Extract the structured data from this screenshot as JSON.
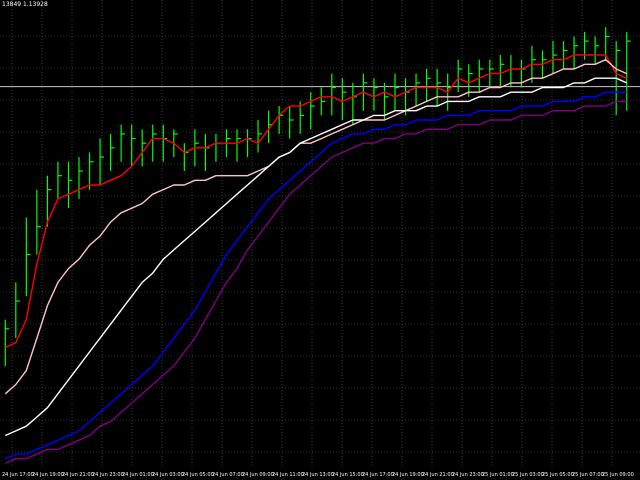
{
  "header": {
    "info": "13849 1.13928"
  },
  "chart_data": {
    "type": "line",
    "title": "",
    "xlabel": "",
    "ylabel": "",
    "grid": true,
    "ylim": [
      0,
      1
    ],
    "reference_line": 0.822,
    "x_tick_labels": [
      "24 Jun 17:00",
      "24 Jun 19:00",
      "24 Jun 21:00",
      "24 Jun 23:00",
      "24 Jun 01:00",
      "24 Jun 03:00",
      "24 Jun 05:00",
      "24 Jun 07:00",
      "24 Jun 09:00",
      "24 Jun 11:00",
      "24 Jun 13:00",
      "24 Jun 15:00",
      "24 Jun 17:00",
      "24 Jun 19:00",
      "24 Jun 21:00",
      "24 Jun 23:00",
      "25 Jun 01:00",
      "25 Jun 03:00",
      "25 Jun 05:00",
      "25 Jun 07:00",
      "25 Jun 09:00"
    ],
    "bars": {
      "color": "#00ff00",
      "close": [
        0.3,
        0.36,
        0.46,
        0.52,
        0.6,
        0.63,
        0.62,
        0.64,
        0.66,
        0.67,
        0.69,
        0.72,
        0.71,
        0.7,
        0.72,
        0.71,
        0.72,
        0.68,
        0.7,
        0.69,
        0.7,
        0.71,
        0.71,
        0.71,
        0.72,
        0.74,
        0.76,
        0.75,
        0.76,
        0.78,
        0.79,
        0.82,
        0.81,
        0.8,
        0.83,
        0.82,
        0.8,
        0.82,
        0.81,
        0.83,
        0.84,
        0.83,
        0.82,
        0.86,
        0.85,
        0.86,
        0.86,
        0.87,
        0.86,
        0.86,
        0.88,
        0.88,
        0.89,
        0.9,
        0.91,
        0.92,
        0.91,
        0.93,
        0.9,
        0.92
      ],
      "high": [
        0.32,
        0.4,
        0.54,
        0.6,
        0.63,
        0.66,
        0.66,
        0.67,
        0.68,
        0.71,
        0.72,
        0.74,
        0.74,
        0.73,
        0.74,
        0.74,
        0.73,
        0.7,
        0.73,
        0.72,
        0.72,
        0.73,
        0.73,
        0.73,
        0.75,
        0.77,
        0.78,
        0.78,
        0.79,
        0.81,
        0.82,
        0.85,
        0.84,
        0.83,
        0.85,
        0.84,
        0.83,
        0.85,
        0.84,
        0.85,
        0.86,
        0.86,
        0.85,
        0.88,
        0.87,
        0.88,
        0.88,
        0.89,
        0.89,
        0.88,
        0.91,
        0.9,
        0.92,
        0.92,
        0.93,
        0.94,
        0.93,
        0.95,
        0.92,
        0.94
      ],
      "low": [
        0.22,
        0.28,
        0.37,
        0.46,
        0.52,
        0.58,
        0.56,
        0.58,
        0.6,
        0.61,
        0.64,
        0.66,
        0.65,
        0.65,
        0.66,
        0.66,
        0.67,
        0.64,
        0.65,
        0.64,
        0.66,
        0.67,
        0.66,
        0.67,
        0.68,
        0.7,
        0.72,
        0.71,
        0.72,
        0.73,
        0.76,
        0.76,
        0.75,
        0.74,
        0.77,
        0.77,
        0.75,
        0.77,
        0.76,
        0.78,
        0.79,
        0.78,
        0.77,
        0.81,
        0.8,
        0.81,
        0.82,
        0.82,
        0.82,
        0.82,
        0.83,
        0.84,
        0.85,
        0.86,
        0.86,
        0.88,
        0.87,
        0.88,
        0.76,
        0.77
      ]
    },
    "series": [
      {
        "color": "#ff0000",
        "values": [
          0.26,
          0.27,
          0.32,
          0.44,
          0.53,
          0.58,
          0.59,
          0.6,
          0.61,
          0.61,
          0.62,
          0.63,
          0.65,
          0.68,
          0.71,
          0.71,
          0.7,
          0.68,
          0.69,
          0.69,
          0.7,
          0.7,
          0.7,
          0.71,
          0.7,
          0.73,
          0.76,
          0.78,
          0.78,
          0.79,
          0.8,
          0.8,
          0.79,
          0.8,
          0.81,
          0.8,
          0.81,
          0.8,
          0.81,
          0.82,
          0.82,
          0.82,
          0.81,
          0.84,
          0.83,
          0.84,
          0.85,
          0.85,
          0.86,
          0.86,
          0.87,
          0.87,
          0.88,
          0.88,
          0.89,
          0.89,
          0.89,
          0.89,
          0.85,
          0.84
        ]
      },
      {
        "color": "#ffc0cb",
        "values": [
          0.16,
          0.18,
          0.21,
          0.28,
          0.35,
          0.4,
          0.43,
          0.45,
          0.48,
          0.5,
          0.53,
          0.55,
          0.56,
          0.57,
          0.59,
          0.6,
          0.61,
          0.61,
          0.62,
          0.62,
          0.63,
          0.63,
          0.63,
          0.63,
          0.64,
          0.65,
          0.67,
          0.68,
          0.7,
          0.7,
          0.71,
          0.72,
          0.73,
          0.74,
          0.75,
          0.75,
          0.75,
          0.76,
          0.77,
          0.78,
          0.79,
          0.8,
          0.8,
          0.8,
          0.81,
          0.81,
          0.82,
          0.82,
          0.83,
          0.83,
          0.84,
          0.84,
          0.85,
          0.86,
          0.86,
          0.87,
          0.87,
          0.88,
          0.86,
          0.85
        ]
      },
      {
        "color": "#ffffff",
        "values": [
          0.07,
          0.08,
          0.09,
          0.11,
          0.13,
          0.16,
          0.19,
          0.22,
          0.25,
          0.28,
          0.31,
          0.34,
          0.37,
          0.4,
          0.42,
          0.45,
          0.47,
          0.49,
          0.51,
          0.53,
          0.55,
          0.57,
          0.59,
          0.61,
          0.63,
          0.65,
          0.67,
          0.68,
          0.7,
          0.71,
          0.72,
          0.73,
          0.74,
          0.75,
          0.75,
          0.76,
          0.76,
          0.77,
          0.77,
          0.77,
          0.78,
          0.78,
          0.79,
          0.79,
          0.79,
          0.8,
          0.8,
          0.8,
          0.81,
          0.81,
          0.81,
          0.82,
          0.82,
          0.82,
          0.83,
          0.83,
          0.84,
          0.84,
          0.84,
          0.83
        ]
      },
      {
        "color": "#0000ff",
        "values": [
          0.02,
          0.03,
          0.03,
          0.04,
          0.05,
          0.06,
          0.07,
          0.08,
          0.1,
          0.12,
          0.14,
          0.16,
          0.18,
          0.2,
          0.22,
          0.25,
          0.28,
          0.31,
          0.34,
          0.38,
          0.42,
          0.46,
          0.49,
          0.52,
          0.55,
          0.58,
          0.6,
          0.62,
          0.64,
          0.66,
          0.68,
          0.7,
          0.71,
          0.72,
          0.72,
          0.73,
          0.73,
          0.74,
          0.74,
          0.75,
          0.75,
          0.75,
          0.76,
          0.76,
          0.76,
          0.77,
          0.77,
          0.77,
          0.77,
          0.78,
          0.78,
          0.78,
          0.79,
          0.79,
          0.79,
          0.8,
          0.8,
          0.81,
          0.81,
          0.81
        ]
      },
      {
        "color": "#800080",
        "values": [
          0.01,
          0.02,
          0.02,
          0.03,
          0.04,
          0.04,
          0.05,
          0.06,
          0.07,
          0.09,
          0.1,
          0.12,
          0.14,
          0.16,
          0.18,
          0.2,
          0.22,
          0.25,
          0.28,
          0.32,
          0.36,
          0.4,
          0.43,
          0.47,
          0.5,
          0.53,
          0.56,
          0.59,
          0.61,
          0.63,
          0.65,
          0.67,
          0.68,
          0.69,
          0.7,
          0.7,
          0.71,
          0.71,
          0.72,
          0.72,
          0.73,
          0.73,
          0.73,
          0.74,
          0.74,
          0.74,
          0.75,
          0.75,
          0.75,
          0.76,
          0.76,
          0.76,
          0.77,
          0.77,
          0.77,
          0.78,
          0.78,
          0.78,
          0.79,
          0.79
        ]
      }
    ]
  }
}
